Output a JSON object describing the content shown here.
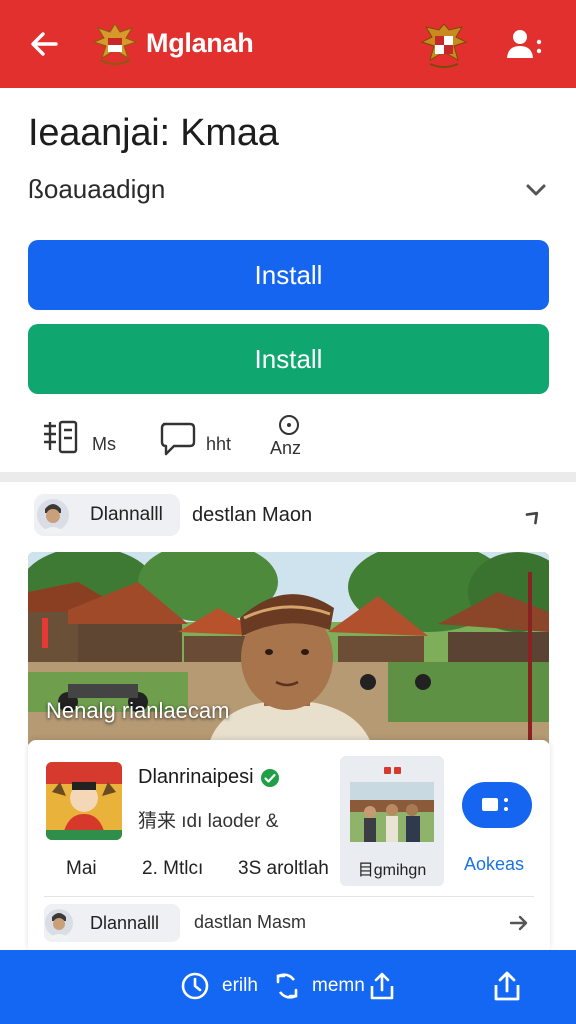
{
  "app_bar": {
    "title": "Mglanah",
    "icons": [
      "back-arrow-icon",
      "garuda-logo-icon",
      "emblem-icon",
      "user-settings-icon"
    ]
  },
  "header": {
    "title": "Ieaanjai: Kmaa",
    "subtitle": "ßoauaadign"
  },
  "buttons": {
    "primary_label": "Install",
    "secondary_label": "Install"
  },
  "stats": [
    {
      "icon": "list-icon",
      "label": "Ms"
    },
    {
      "icon": "chat-bubble-icon",
      "label": "hht"
    },
    {
      "icon": "info-icon",
      "label": "Anz"
    }
  ],
  "post": {
    "chip_label": "Dlannalll",
    "author": "destlan Maon",
    "photo_caption": "Nenalg rianlaecam"
  },
  "card": {
    "name": "Dlanrinaipesi",
    "meta": "猜来  ıdı laoder &",
    "stats": [
      "Mai",
      "2. Mtlcı",
      "3S aroltlah"
    ],
    "media_label": "目gmihgn",
    "action_label": "Aokeas",
    "chip_label": "Dlannalll",
    "author": "dastlan Masm"
  },
  "bottom_bar": {
    "items": [
      {
        "icon": "clock-icon",
        "label": "erilh"
      },
      {
        "icon": "refresh-icon",
        "label": "memn"
      },
      {
        "icon": "share-icon",
        "label": ""
      },
      {
        "icon": "upload-icon",
        "label": ""
      }
    ]
  },
  "colors": {
    "app_bar": "#e2302e",
    "primary_button": "#1565f0",
    "secondary_button": "#10a670",
    "bottom_bar": "#1467f2",
    "link": "#1a73e8"
  }
}
